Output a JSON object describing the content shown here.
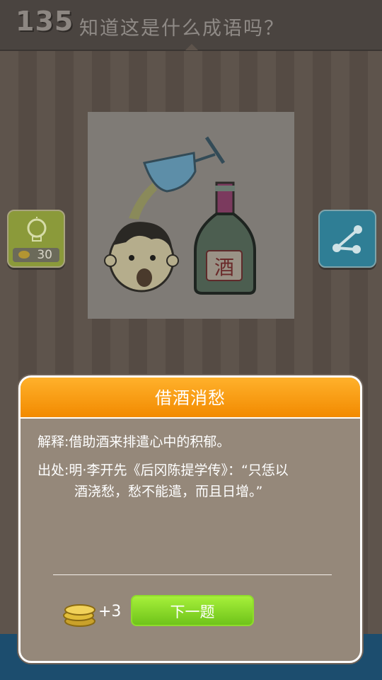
{
  "header": {
    "level": "135",
    "question": "知道这是什么成语吗？"
  },
  "puzzle": {
    "bottom_label": "酒",
    "icons": [
      "wine-glass-icon",
      "dizzy-face-icon",
      "liquor-bottle-icon"
    ]
  },
  "hint_button": {
    "icon": "lightbulb-icon",
    "cost": "30"
  },
  "share_button": {
    "icon": "share-icon"
  },
  "answer_panel": {
    "title": "借酒消愁",
    "explanation": "解释:借助酒来排遣心中的积郁。",
    "source_line1": "出处:明·李开先《后冈陈提学传》：“只恁以",
    "source_line2": "酒浇愁，愁不能遣，而且日增。”",
    "reward": "+3",
    "next_label": "下一题"
  },
  "colors": {
    "accent_orange": "#f28a00",
    "next_green": "#7fd020",
    "panel_bg": "#95887a"
  }
}
